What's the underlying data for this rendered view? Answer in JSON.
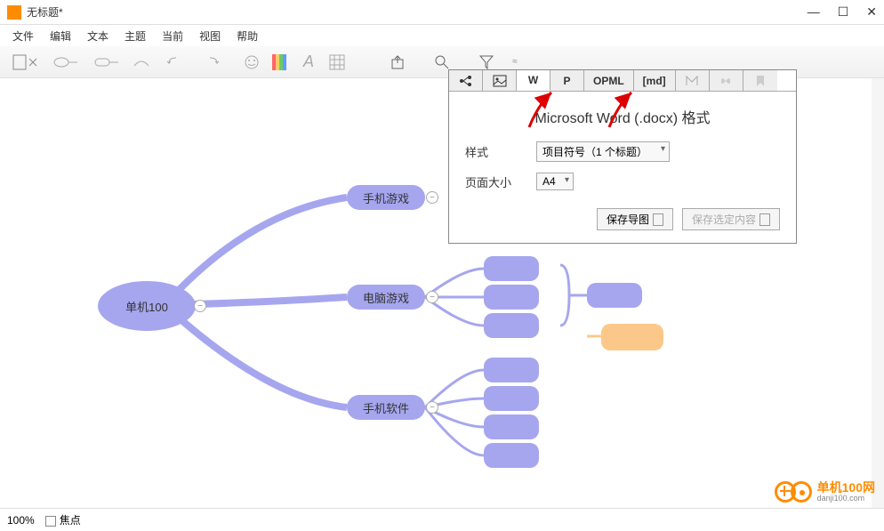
{
  "window": {
    "title": "无标题*"
  },
  "menu": {
    "file": "文件",
    "edit": "编辑",
    "text": "文本",
    "theme": "主题",
    "current": "当前",
    "view": "视图",
    "help": "帮助"
  },
  "export": {
    "tabs": {
      "w": "W",
      "p": "P",
      "opml": "OPML",
      "md": "[md]"
    },
    "title": "Microsoft Word (.docx) 格式",
    "style_label": "样式",
    "style_value": "项目符号（1 个标题）",
    "size_label": "页面大小",
    "size_value": "A4",
    "save_map": "保存导图",
    "save_selected": "保存选定内容"
  },
  "mindmap": {
    "root": "单机100",
    "child1": "手机游戏",
    "child2": "电脑游戏",
    "child3": "手机软件"
  },
  "status": {
    "zoom": "100%",
    "focus": "焦点"
  },
  "watermark": {
    "brand": "单机100网",
    "url": "danji100.com"
  }
}
